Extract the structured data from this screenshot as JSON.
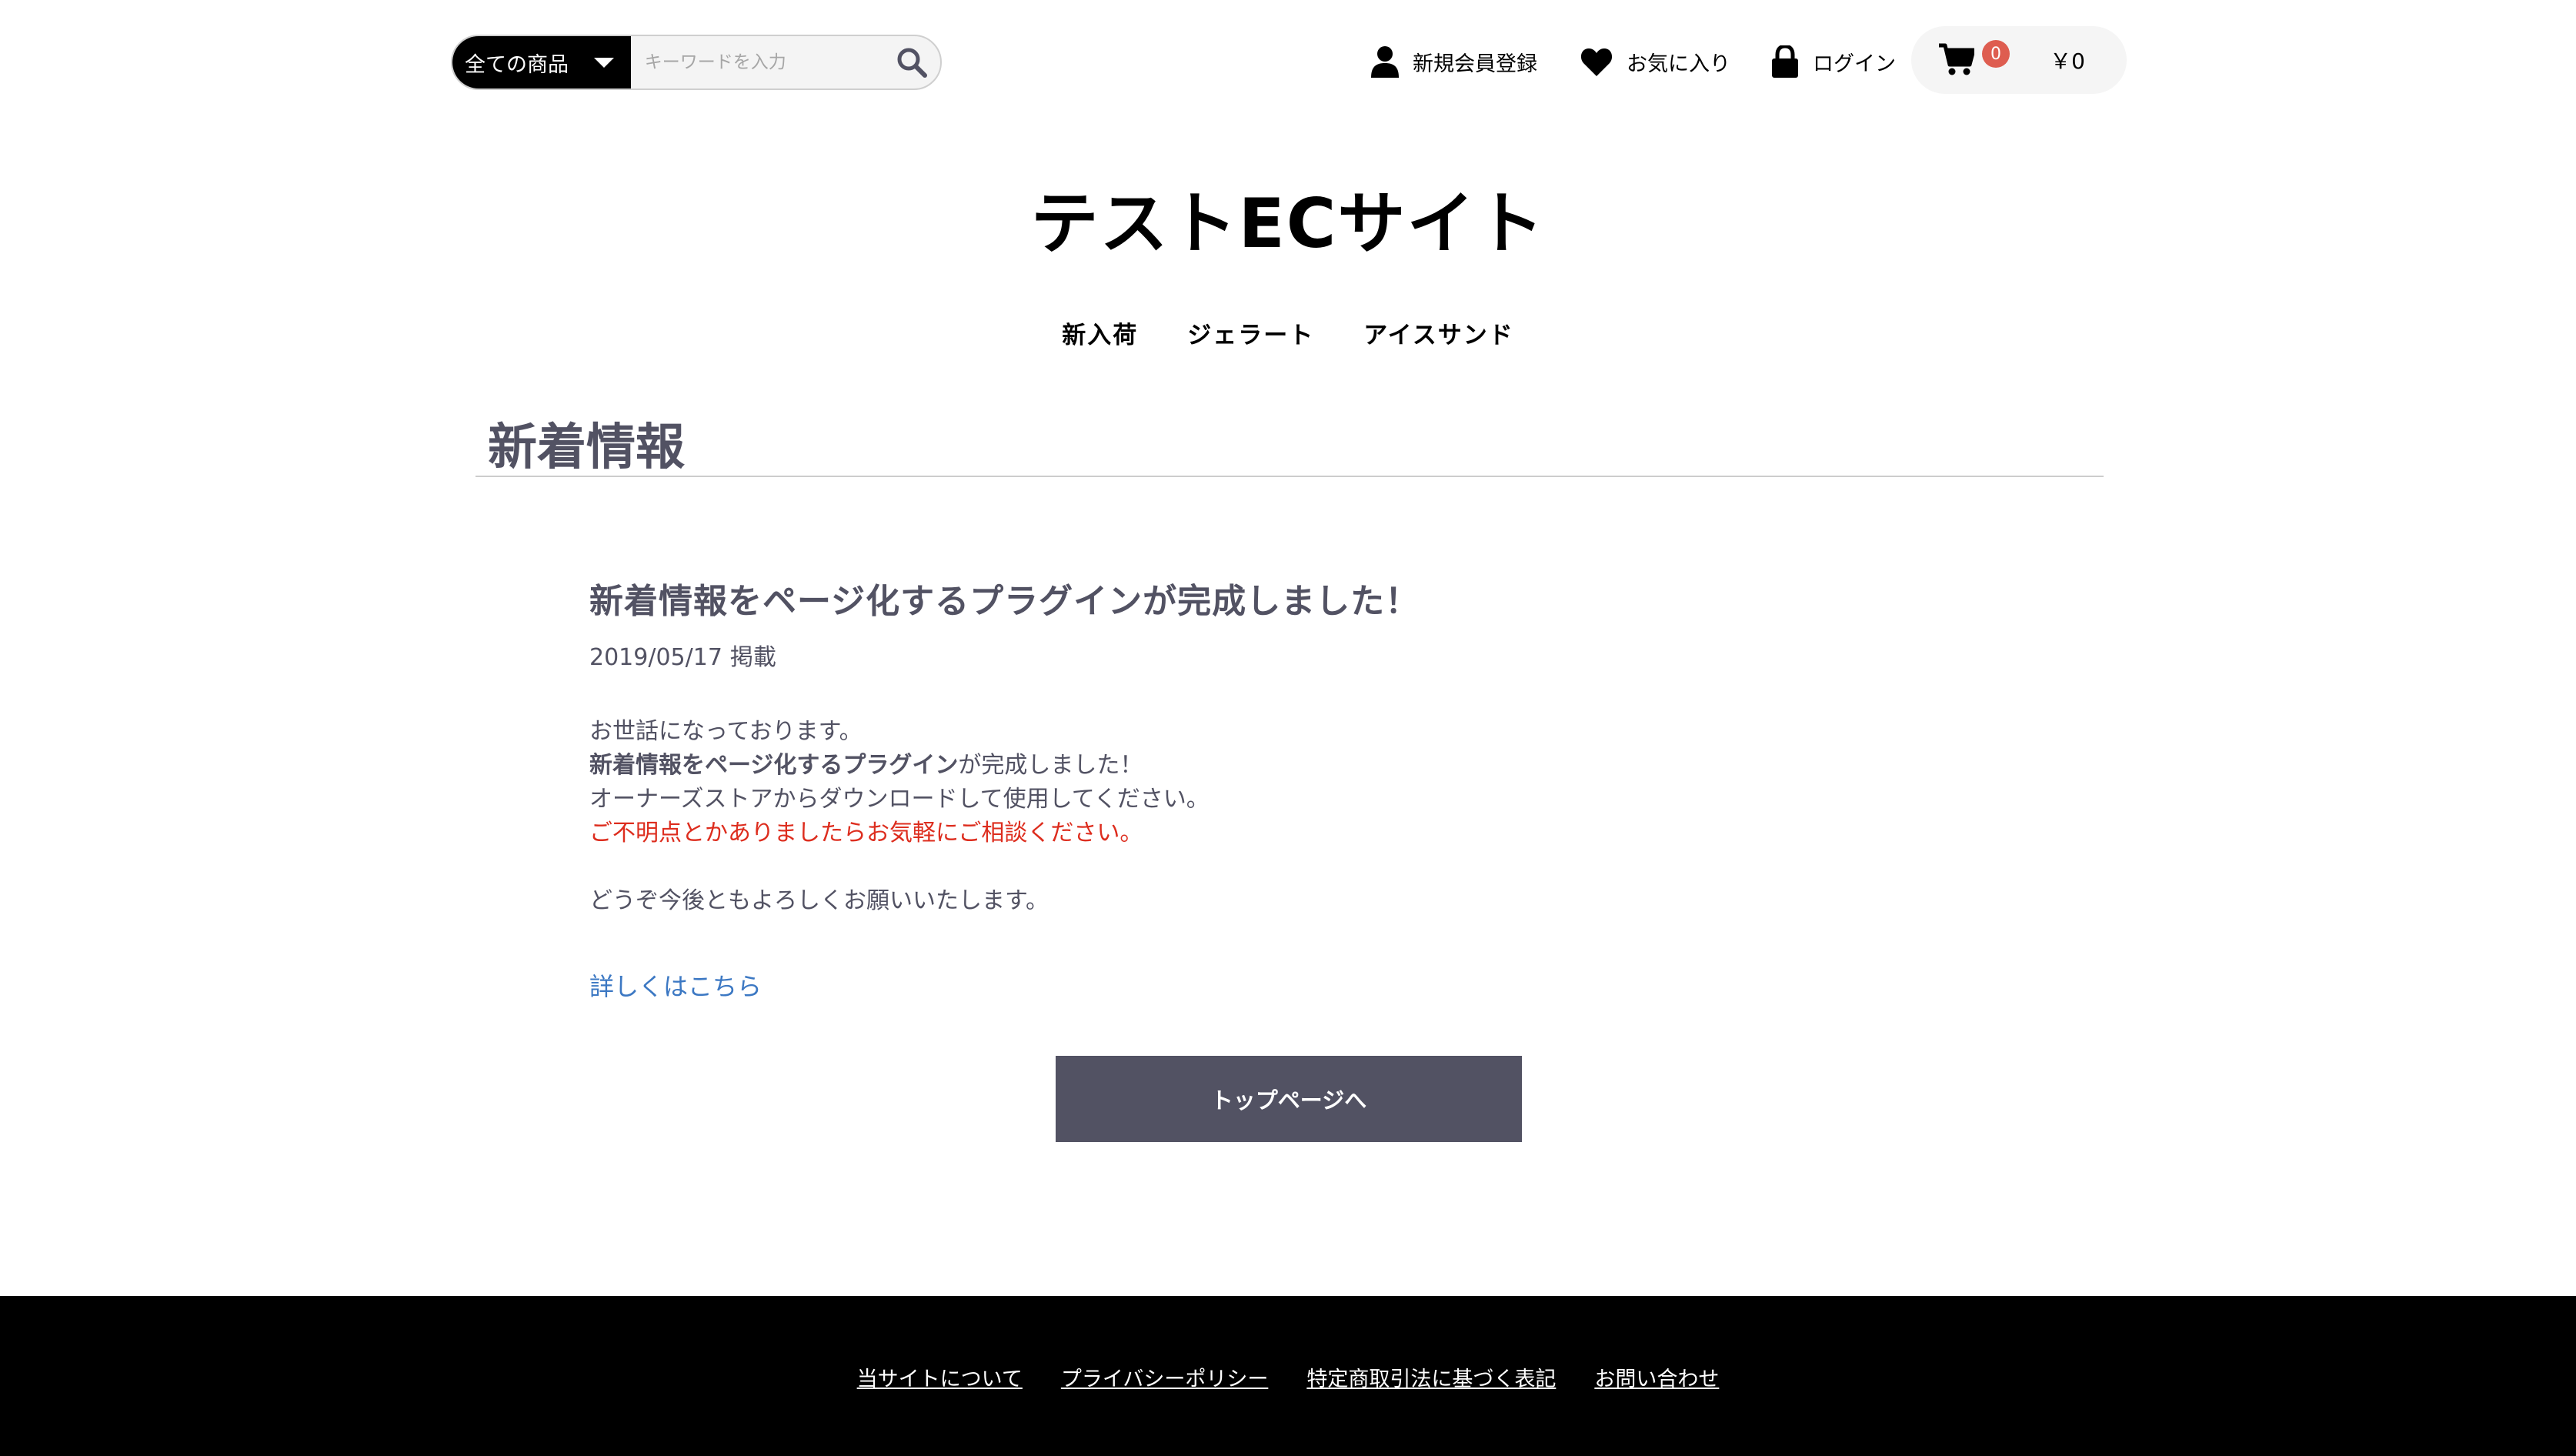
{
  "header": {
    "search": {
      "category_label": "全ての商品",
      "placeholder": "キーワードを入力"
    },
    "nav": {
      "register_label": "新規会員登録",
      "favorites_label": "お気に入り",
      "login_label": "ログイン"
    },
    "cart": {
      "count": "0",
      "total": "￥0"
    },
    "site_title": "テストECサイト",
    "categories": [
      "新入荷",
      "ジェラート",
      "アイスサンド"
    ]
  },
  "page_title": "新着情報",
  "news": {
    "title": "新着情報をページ化するプラグインが完成しました！",
    "date": "2019/05/17",
    "date_suffix": "掲載",
    "body": {
      "line1": "お世話になっております。",
      "line2_bold": "新着情報をページ化するプラグイン",
      "line2_rest": "が完成しました！",
      "line3": "オーナーズストアからダウンロードして使用してください。",
      "line4_red": "ご不明点とかありましたらお気軽にご相談ください。",
      "line5": "どうぞ今後ともよろしくお願いいたします。"
    },
    "detail_link": "詳しくはこちら"
  },
  "top_button_label": "トップページへ",
  "footer": {
    "links": [
      "当サイトについて",
      "プライバシーポリシー",
      "特定商取引法に基づく表記",
      "お問い合わせ"
    ]
  },
  "colors": {
    "text": "#525263",
    "accent_red": "#dd2d1e",
    "link_blue": "#3c78c3",
    "badge": "#de5d50",
    "button": "#525263",
    "footer_bg": "#000000"
  },
  "icons": [
    "search-icon",
    "user-icon",
    "heart-icon",
    "lock-icon",
    "cart-icon",
    "caret-down-icon"
  ]
}
